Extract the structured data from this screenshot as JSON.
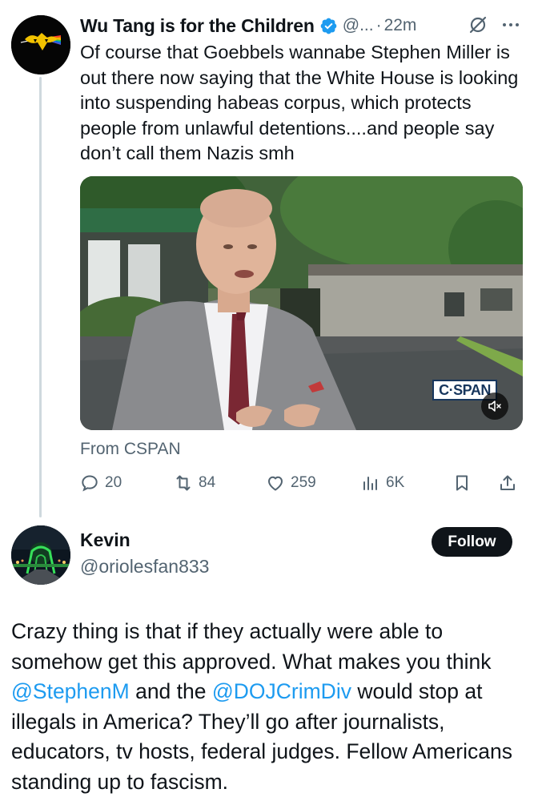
{
  "tweet": {
    "author_name": "Wu Tang is for the Children",
    "handle": "@...",
    "separator": "·",
    "time": "22m",
    "text": "Of course that Goebbels wannabe Stephen Miller is out there now saying that the White House is looking into suspending habeas corpus, which protects people from unlawful detentions....and people say don’t call them Nazis smh",
    "media": {
      "watermark": "C·SPAN",
      "muted": true
    },
    "source_label": "From CSPAN",
    "stats": {
      "replies": "20",
      "retweets": "84",
      "likes": "259",
      "views": "6K"
    }
  },
  "reply_user": {
    "name": "Kevin",
    "handle": "@oriolesfan833",
    "follow_label": "Follow"
  },
  "reply": {
    "text_1": "Crazy thing is that if they actually were able to somehow get this approved. What makes you think ",
    "mention_1": "@StephenM",
    "text_2": " and the ",
    "mention_2": "@DOJCrimDiv",
    "text_3": " would stop at illegals in America? They’ll go after journalists, educators, tv hosts, federal judges. Fellow Americans standing up to fascism."
  },
  "colors": {
    "text": "#0f1419",
    "secondary": "#536471",
    "link": "#1d9bf0",
    "verified": "#1d9bf0",
    "divider": "#cfd9de",
    "follow_button": "#0f1419"
  },
  "icons": [
    "verified-badge-icon",
    "grok-icon",
    "more-icon",
    "reply-icon",
    "retweet-icon",
    "like-icon",
    "views-icon",
    "bookmark-icon",
    "share-icon",
    "mute-icon"
  ]
}
